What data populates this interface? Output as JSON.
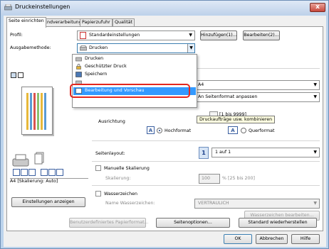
{
  "window": {
    "title": "Druckeinstellungen",
    "close": "x"
  },
  "tabs": [
    {
      "label": "Seite einrichten"
    },
    {
      "label": "Endverarbeitung"
    },
    {
      "label": "Papierzufuhr"
    },
    {
      "label": "Qualität"
    }
  ],
  "profile": {
    "label": "Profil:",
    "value": "Standardeinstellungen",
    "add_button": "Hinzufügen(1)...",
    "edit_button": "Bearbeiten(2)..."
  },
  "output": {
    "label": "Ausgabemethode:",
    "value": "Drucken",
    "options": [
      "Drucken",
      "Geschützter Druck",
      "Speichern",
      "Bearbeitung und Vorschau"
    ],
    "selected_index": 4
  },
  "right": {
    "paper_size": "A4",
    "output_size": "An Seitenformat anpassen",
    "tooltip": "Druckaufträge usw. kombinieren",
    "copies_range": "[1 bis 9999]"
  },
  "orientation": {
    "label": "Ausrichtung",
    "portrait": "Hochformat",
    "landscape": "Querformat"
  },
  "preview": {
    "caption": "A4 [Skalierung: Auto]",
    "settings_button": "Einstellungen anzeigen"
  },
  "layout": {
    "label": "Seitenlayout:",
    "value": "1 auf 1",
    "number": "1"
  },
  "scaling": {
    "checkbox": "Manuelle Skalierung",
    "label": "Skalierung:",
    "value": "100",
    "range": "% [25 bis 200]"
  },
  "watermark": {
    "checkbox": "Wasserzeichen",
    "name_label": "Name Wasserzeichen:",
    "value": "VERTRAULICH",
    "edit_button": "Wasserzeichen bearbeiten..."
  },
  "footer": {
    "custom_paper": "Benutzerdefiniertes Papierformat...",
    "page_options": "Seitenoptionen...",
    "restore": "Standard wiederherstellen",
    "ok": "OK",
    "cancel": "Abbrechen",
    "help": "Hilfe"
  },
  "colors": {
    "highlight": "#3399ff",
    "annotation": "#e4261e",
    "tooltip_bg": "#ffffe1"
  }
}
